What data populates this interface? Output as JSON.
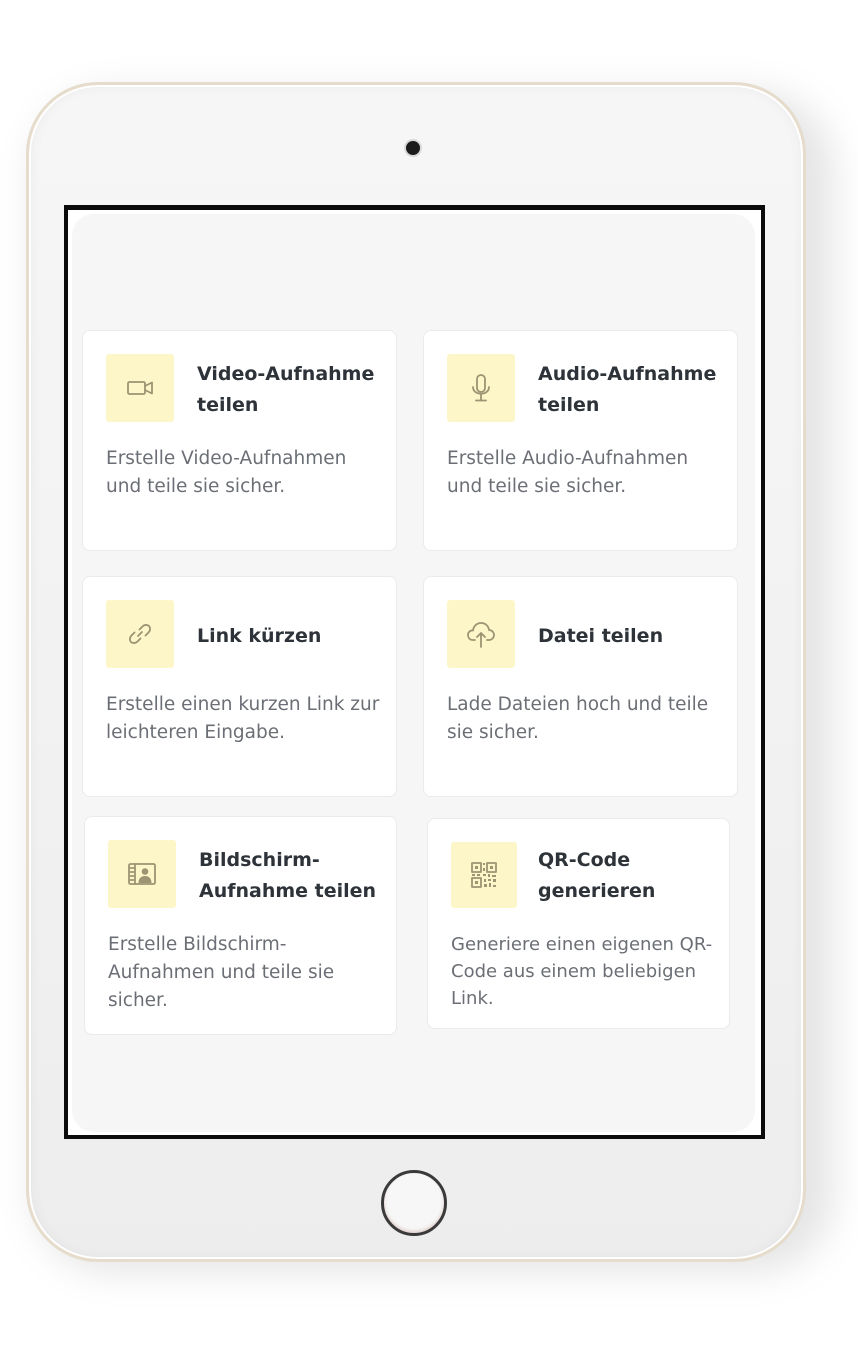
{
  "cards": [
    {
      "icon": "video-camera-icon",
      "title": "Video-Aufnahme teilen",
      "description": "Erstelle Video-Aufnahmen und teile sie sicher."
    },
    {
      "icon": "microphone-icon",
      "title": "Audio-Aufnahme teilen",
      "description": "Erstelle Audio-Aufnahmen und teile sie sicher."
    },
    {
      "icon": "link-icon",
      "title": "Link kürzen",
      "description": "Erstelle einen kurzen Link zur leichteren Eingabe."
    },
    {
      "icon": "cloud-upload-icon",
      "title": "Datei teilen",
      "description": "Lade Dateien hoch und teile sie sicher."
    },
    {
      "icon": "screen-recording-icon",
      "title": "Bildschirm-Aufnahme teilen",
      "description": "Erstelle Bildschirm-Aufnahmen und teile sie sicher."
    },
    {
      "icon": "qr-code-icon",
      "title": "QR-Code generieren",
      "description": "Generiere einen eigenen QR-Code aus einem beliebigen Link."
    }
  ],
  "colors": {
    "icon_background": "#fcf6c8",
    "icon_stroke": "#9c9472",
    "title": "#2d3339",
    "description": "#6b6f75",
    "panel_background": "#f5f6f5"
  }
}
